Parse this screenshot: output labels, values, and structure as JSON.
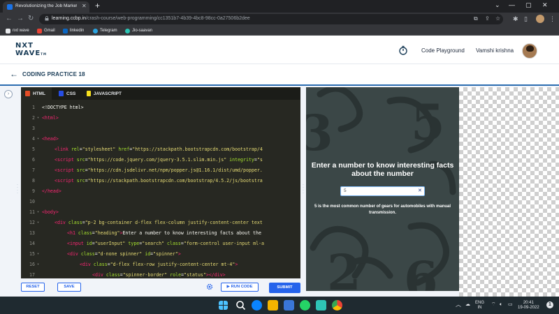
{
  "browser": {
    "tab_title": "Revolutionizing the Job Market |",
    "url_host": "learning.ccbp.in",
    "url_path": "/crash-course/web-programming/cc1351b7-4b39-4bc8-98cc-0a27506b2dee",
    "bookmarks": [
      {
        "label": "nxt wave",
        "color": "#e8eaed"
      },
      {
        "label": "Gmail",
        "color": "#ea4335"
      },
      {
        "label": "linkedin",
        "color": "#0a66c2"
      },
      {
        "label": "Telegram",
        "color": "#2aa3df"
      },
      {
        "label": "Jio-saavan",
        "color": "#2bc5b4"
      }
    ]
  },
  "header": {
    "logo_line1": "NXT",
    "logo_line2": "WAVE",
    "logo_tm": "TM",
    "code_playground": "Code Playground",
    "user_name": "Vamshi krishna"
  },
  "practice": {
    "title": "CODING PRACTICE 18"
  },
  "editor": {
    "tabs": [
      {
        "label": "HTML",
        "active": true,
        "icon": "html-icon",
        "color": "#e34c26"
      },
      {
        "label": "CSS",
        "active": false,
        "icon": "css-icon",
        "color": "#264de4"
      },
      {
        "label": "JAVASCRIPT",
        "active": false,
        "icon": "js-icon",
        "color": "#f7df1e"
      }
    ],
    "lines": [
      {
        "n": "1",
        "fold": "",
        "indent": 0,
        "parts": [
          [
            "d",
            "<!DOCTYPE html>"
          ]
        ]
      },
      {
        "n": "2",
        "fold": "▾",
        "indent": 0,
        "parts": [
          [
            "t",
            "<html>"
          ]
        ]
      },
      {
        "n": "3",
        "fold": "",
        "indent": 0,
        "parts": []
      },
      {
        "n": "4",
        "fold": "▾",
        "indent": 0,
        "parts": [
          [
            "t",
            "<head>"
          ]
        ]
      },
      {
        "n": "5",
        "fold": "",
        "indent": 1,
        "parts": [
          [
            "t",
            "<link "
          ],
          [
            "a",
            "rel"
          ],
          [
            "d",
            "="
          ],
          [
            "s",
            "\"stylesheet\""
          ],
          [
            "d",
            " "
          ],
          [
            "a",
            "href"
          ],
          [
            "d",
            "="
          ],
          [
            "s",
            "\"https://stackpath.bootstrapcdn.com/bootstrap/4"
          ]
        ]
      },
      {
        "n": "6",
        "fold": "",
        "indent": 1,
        "parts": [
          [
            "t",
            "<script "
          ],
          [
            "a",
            "src"
          ],
          [
            "d",
            "="
          ],
          [
            "s",
            "\"https://code.jquery.com/jquery-3.5.1.slim.min.js\""
          ],
          [
            "d",
            " "
          ],
          [
            "a",
            "integrity"
          ],
          [
            "d",
            "="
          ],
          [
            "s",
            "\"s"
          ]
        ]
      },
      {
        "n": "7",
        "fold": "",
        "indent": 1,
        "parts": [
          [
            "t",
            "<script "
          ],
          [
            "a",
            "src"
          ],
          [
            "d",
            "="
          ],
          [
            "s",
            "\"https://cdn.jsdelivr.net/npm/popper.js@1.16.1/dist/umd/popper."
          ]
        ]
      },
      {
        "n": "8",
        "fold": "",
        "indent": 1,
        "parts": [
          [
            "t",
            "<script "
          ],
          [
            "a",
            "src"
          ],
          [
            "d",
            "="
          ],
          [
            "s",
            "\"https://stackpath.bootstrapcdn.com/bootstrap/4.5.2/js/bootstra"
          ]
        ]
      },
      {
        "n": "9",
        "fold": "",
        "indent": 0,
        "parts": [
          [
            "t",
            "</head>"
          ]
        ]
      },
      {
        "n": "10",
        "fold": "",
        "indent": 0,
        "parts": []
      },
      {
        "n": "11",
        "fold": "▾",
        "indent": 0,
        "parts": [
          [
            "t",
            "<body>"
          ]
        ]
      },
      {
        "n": "12",
        "fold": "▾",
        "indent": 1,
        "parts": [
          [
            "t",
            "<div "
          ],
          [
            "a",
            "class"
          ],
          [
            "d",
            "="
          ],
          [
            "s",
            "\"p-2 bg-container d-flex flex-column justify-content-center text"
          ]
        ]
      },
      {
        "n": "13",
        "fold": "",
        "indent": 2,
        "parts": [
          [
            "t",
            "<h1 "
          ],
          [
            "a",
            "class"
          ],
          [
            "d",
            "="
          ],
          [
            "s",
            "\"heading\""
          ],
          [
            "t",
            ">"
          ],
          [
            "d",
            "Enter a number to know interesting facts about the"
          ]
        ]
      },
      {
        "n": "14",
        "fold": "",
        "indent": 2,
        "parts": [
          [
            "t",
            "<input "
          ],
          [
            "a",
            "id"
          ],
          [
            "d",
            "="
          ],
          [
            "s",
            "\"userInput\""
          ],
          [
            "d",
            " "
          ],
          [
            "a",
            "type"
          ],
          [
            "d",
            "="
          ],
          [
            "s",
            "\"search\""
          ],
          [
            "d",
            " "
          ],
          [
            "a",
            "class"
          ],
          [
            "d",
            "="
          ],
          [
            "s",
            "\"form-control user-input ml-a"
          ]
        ]
      },
      {
        "n": "15",
        "fold": "▾",
        "indent": 2,
        "parts": [
          [
            "t",
            "<div "
          ],
          [
            "a",
            "class"
          ],
          [
            "d",
            "="
          ],
          [
            "s",
            "\"d-none spinner\""
          ],
          [
            "d",
            " "
          ],
          [
            "a",
            "id"
          ],
          [
            "d",
            "="
          ],
          [
            "s",
            "\"spinner\""
          ],
          [
            "t",
            ">"
          ]
        ]
      },
      {
        "n": "16",
        "fold": "▾",
        "indent": 3,
        "parts": [
          [
            "t",
            "<div "
          ],
          [
            "a",
            "class"
          ],
          [
            "d",
            "="
          ],
          [
            "s",
            "\"d-flex flex-row justify-content-center mt-4\""
          ],
          [
            "t",
            ">"
          ]
        ]
      },
      {
        "n": "17",
        "fold": "",
        "indent": 4,
        "parts": [
          [
            "t",
            "<div "
          ],
          [
            "a",
            "class"
          ],
          [
            "d",
            "="
          ],
          [
            "s",
            "\"spinner-border\""
          ],
          [
            "d",
            " "
          ],
          [
            "a",
            "role"
          ],
          [
            "d",
            "="
          ],
          [
            "s",
            "\"status\""
          ],
          [
            "t",
            "></div>"
          ]
        ]
      }
    ],
    "buttons": {
      "reset": "RESET",
      "save": "SAVE",
      "run": "▶ RUN CODE",
      "submit": "SUBMIT"
    }
  },
  "preview": {
    "heading": "Enter a number to know interesting facts about the number",
    "input_value": "5",
    "fact": "5 is the most common number of gears for automobiles with manual transmission."
  },
  "taskbar": {
    "lang_line1": "ENG",
    "lang_line2": "IN",
    "time": "20:41",
    "date": "19-09-2022"
  }
}
